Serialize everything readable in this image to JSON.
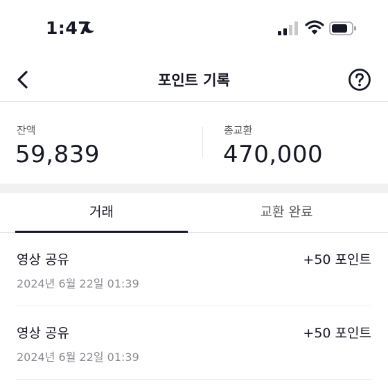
{
  "status_bar": {
    "time": "1:47",
    "icons": [
      "moon-icon",
      "cellular-signal-icon",
      "wifi-icon",
      "battery-icon"
    ]
  },
  "header": {
    "title": "포인트 기록",
    "back_icon": "chevron-left-icon",
    "help_icon": "help-circle-icon"
  },
  "summary": {
    "balance_label": "잔액",
    "balance_value": "59,839",
    "total_exchanged_label": "총교환",
    "total_exchanged_value": "470,000"
  },
  "tabs": [
    {
      "label": "거래",
      "active": true
    },
    {
      "label": "교환 완료",
      "active": false
    }
  ],
  "transactions": [
    {
      "type": "영상 공유",
      "date": "2024년 6월 22일 01:39",
      "points": "+50 포인트"
    },
    {
      "type": "영상 공유",
      "date": "2024년 6월 22일 01:39",
      "points": "+50 포인트"
    }
  ],
  "colors": {
    "text_primary": "#161823",
    "text_secondary": "#8a8b91",
    "divider": "#e3e3e6",
    "section_gap": "#f1f1f2"
  }
}
